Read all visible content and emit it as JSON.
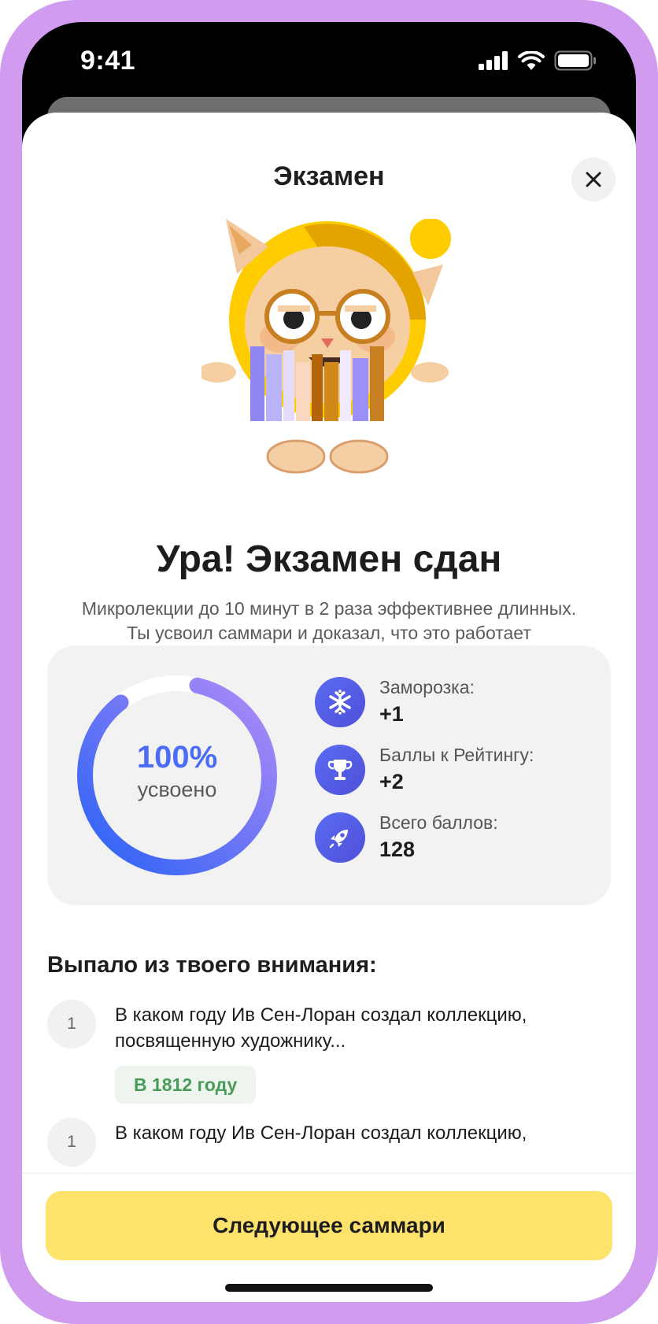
{
  "status_bar": {
    "time": "9:41",
    "icons": [
      "cellular-signal-icon",
      "wifi-icon",
      "battery-icon"
    ]
  },
  "header": {
    "title": "Экзамен",
    "close_icon": "close-icon"
  },
  "hero": {
    "illustration": "cat-with-books-mascot",
    "headline": "Ура! Экзамен сдан",
    "subtitle": "Микролекции до 10 минут в 2 раза эффективнее длинных. Ты усвоил саммари и доказал, что это работает"
  },
  "stats": {
    "progress": {
      "percent": 100,
      "value_label": "100%",
      "caption": "усвоено"
    },
    "items": [
      {
        "icon": "snowflake-icon",
        "label": "Заморозка:",
        "value": "+1"
      },
      {
        "icon": "trophy-icon",
        "label": "Баллы к Рейтингу:",
        "value": "+2"
      },
      {
        "icon": "rocket-icon",
        "label": "Всего баллов:",
        "value": "128"
      }
    ]
  },
  "missed": {
    "title": "Выпало из твоего внимания:",
    "questions": [
      {
        "number": "1",
        "text": "В каком году Ив Сен-Лоран создал коллекцию, посвященную художнику...",
        "answer": "В 1812 году"
      },
      {
        "number": "1",
        "text": "В каком году Ив Сен-Лоран создал коллекцию,"
      }
    ]
  },
  "footer": {
    "next_button": "Следующее саммари"
  },
  "colors": {
    "frame": "#d19cf0",
    "accent_blue": "#4d6cf5",
    "button_yellow": "#fde26c",
    "answer_green": "#4a9a5a",
    "card_bg": "#f2f2f3"
  }
}
